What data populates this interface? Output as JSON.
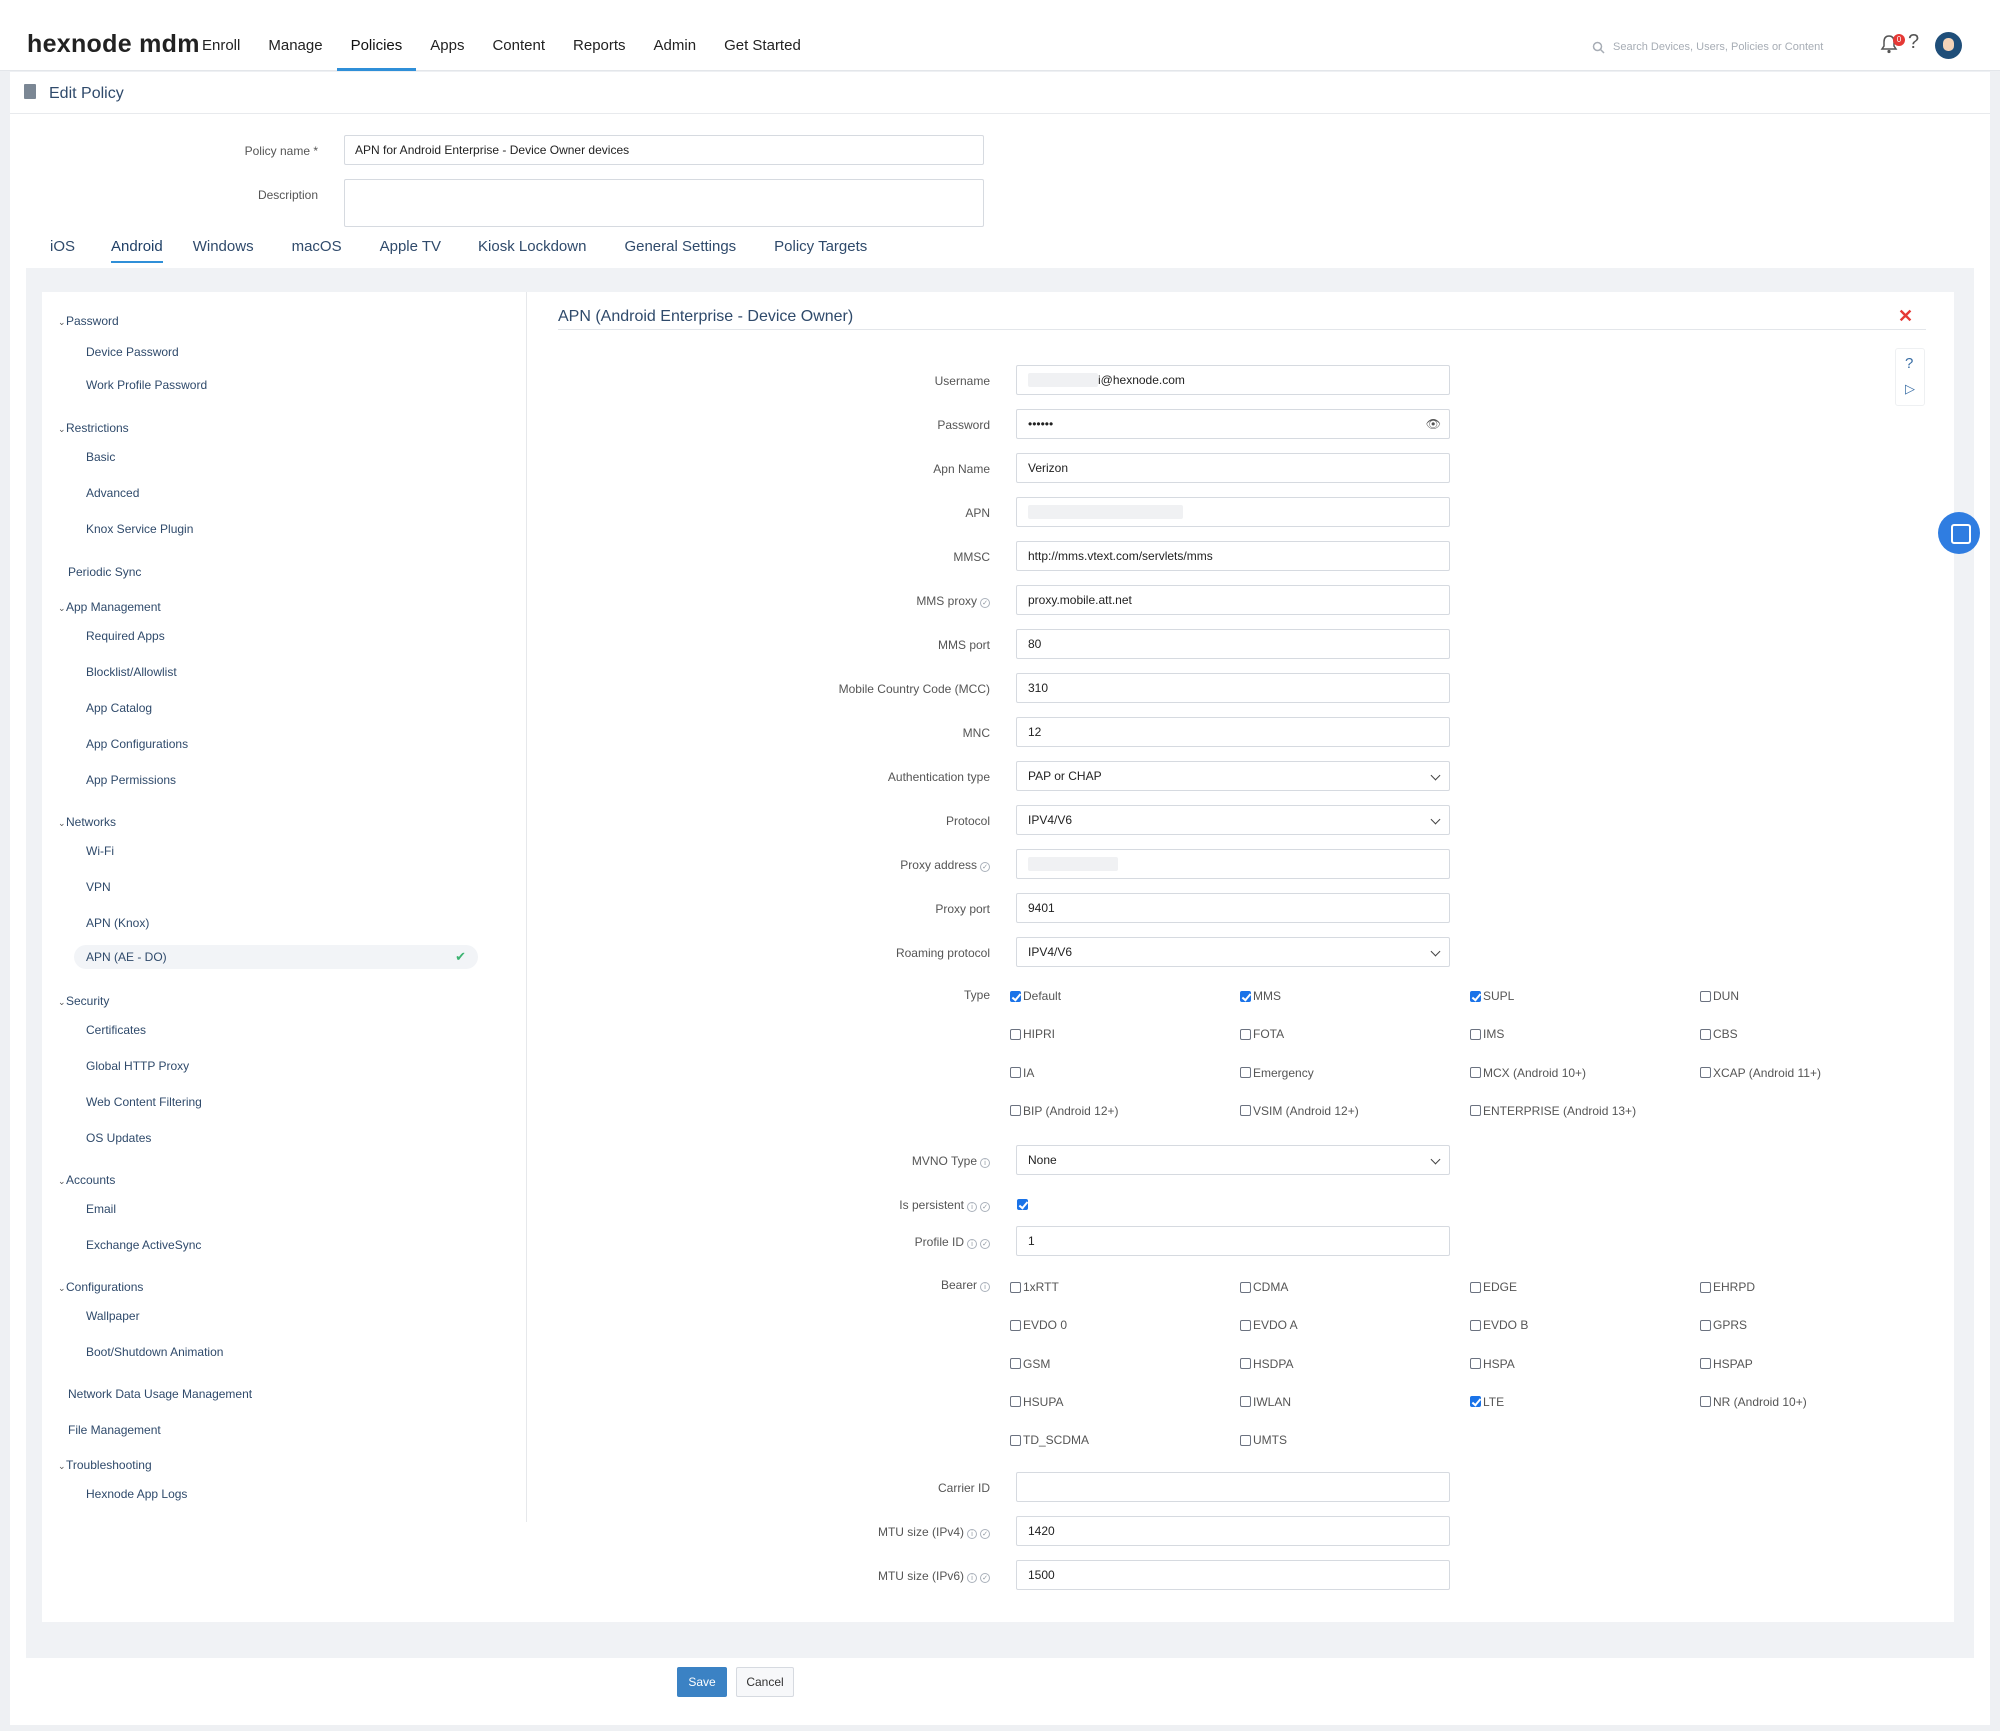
{
  "app": {
    "logo": "hexnode mdm",
    "nav": [
      "Enroll",
      "Manage",
      "Policies",
      "Apps",
      "Content",
      "Reports",
      "Admin",
      "Get Started"
    ],
    "active_nav": "Policies",
    "search_placeholder": "Search Devices, Users, Policies or Content",
    "notification_count": "0"
  },
  "page": {
    "title": "Edit Policy",
    "policy_name_label": "Policy name *",
    "policy_name_value": "APN for Android Enterprise - Device Owner devices",
    "description_label": "Description",
    "description_value": ""
  },
  "tabs": [
    "iOS",
    "Android",
    "Windows",
    "macOS",
    "Apple TV",
    "Kiosk Lockdown",
    "General Settings",
    "Policy Targets"
  ],
  "sidebar": {
    "groups": [
      {
        "label": "Password",
        "items": [
          "Device Password",
          "Work Profile Password"
        ]
      },
      {
        "label": "Restrictions",
        "items": [
          "Basic",
          "Advanced",
          "Knox Service Plugin"
        ]
      },
      {
        "label": "Periodic Sync",
        "items": []
      },
      {
        "label": "App Management",
        "items": [
          "Required Apps",
          "Blocklist/Allowlist",
          "App Catalog",
          "App Configurations",
          "App Permissions"
        ]
      },
      {
        "label": "Networks",
        "items": [
          "Wi-Fi",
          "VPN",
          "APN (Knox)",
          "APN (AE - DO)"
        ]
      },
      {
        "label": "Security",
        "items": [
          "Certificates",
          "Global HTTP Proxy",
          "Web Content Filtering",
          "OS Updates"
        ]
      },
      {
        "label": "Accounts",
        "items": [
          "Email",
          "Exchange ActiveSync"
        ]
      },
      {
        "label": "Configurations",
        "items": [
          "Wallpaper",
          "Boot/Shutdown Animation"
        ]
      },
      {
        "label": "Network Data Usage Management",
        "items": []
      },
      {
        "label": "File Management",
        "items": []
      },
      {
        "label": "Troubleshooting",
        "items": [
          "Hexnode App Logs"
        ]
      }
    ],
    "active_item": "APN (AE - DO)"
  },
  "section": {
    "title": "APN (Android Enterprise - Device Owner)",
    "fields": {
      "username_label": "Username",
      "username_value": "i@hexnode.com",
      "password_label": "Password",
      "password_value": "••••••",
      "apn_name_label": "Apn Name",
      "apn_name_value": "Verizon",
      "apn_label": "APN",
      "mmsc_label": "MMSC",
      "mmsc_value": "http://mms.vtext.com/servlets/mms",
      "mms_proxy_label": "MMS proxy",
      "mms_proxy_value": "proxy.mobile.att.net",
      "mms_port_label": "MMS port",
      "mms_port_value": "80",
      "mcc_label": "Mobile Country Code (MCC)",
      "mcc_value": "310",
      "mnc_label": "MNC",
      "mnc_value": "12",
      "auth_type_label": "Authentication type",
      "auth_type_value": "PAP or CHAP",
      "protocol_label": "Protocol",
      "protocol_value": "IPV4/V6",
      "proxy_address_label": "Proxy address",
      "proxy_port_label": "Proxy port",
      "proxy_port_value": "9401",
      "roaming_label": "Roaming protocol",
      "roaming_value": "IPV4/V6",
      "type_label": "Type",
      "mvno_label": "MVNO Type",
      "mvno_value": "None",
      "persistent_label": "Is persistent",
      "profile_id_label": "Profile ID",
      "profile_id_value": "1",
      "bearer_label": "Bearer",
      "carrier_id_label": "Carrier ID",
      "carrier_id_value": "",
      "mtu4_label": "MTU size (IPv4)",
      "mtu4_value": "1420",
      "mtu6_label": "MTU size (IPv6)",
      "mtu6_value": "1500"
    },
    "type_options": [
      {
        "label": "Default",
        "checked": true
      },
      {
        "label": "MMS",
        "checked": true
      },
      {
        "label": "SUPL",
        "checked": true
      },
      {
        "label": "DUN",
        "checked": false
      },
      {
        "label": "HIPRI",
        "checked": false
      },
      {
        "label": "FOTA",
        "checked": false
      },
      {
        "label": "IMS",
        "checked": false
      },
      {
        "label": "CBS",
        "checked": false
      },
      {
        "label": "IA",
        "checked": false
      },
      {
        "label": "Emergency",
        "checked": false
      },
      {
        "label": "MCX (Android 10+)",
        "checked": false
      },
      {
        "label": "XCAP (Android 11+)",
        "checked": false
      },
      {
        "label": "BIP (Android 12+)",
        "checked": false
      },
      {
        "label": "VSIM (Android 12+)",
        "checked": false
      },
      {
        "label": "ENTERPRISE (Android 13+)",
        "checked": false
      }
    ],
    "persistent_checked": true,
    "bearer_options": [
      {
        "label": "1xRTT",
        "checked": false
      },
      {
        "label": "CDMA",
        "checked": false
      },
      {
        "label": "EDGE",
        "checked": false
      },
      {
        "label": "EHRPD",
        "checked": false
      },
      {
        "label": "EVDO 0",
        "checked": false
      },
      {
        "label": "EVDO A",
        "checked": false
      },
      {
        "label": "EVDO B",
        "checked": false
      },
      {
        "label": "GPRS",
        "checked": false
      },
      {
        "label": "GSM",
        "checked": false
      },
      {
        "label": "HSDPA",
        "checked": false
      },
      {
        "label": "HSPA",
        "checked": false
      },
      {
        "label": "HSPAP",
        "checked": false
      },
      {
        "label": "HSUPA",
        "checked": false
      },
      {
        "label": "IWLAN",
        "checked": false
      },
      {
        "label": "LTE",
        "checked": true
      },
      {
        "label": "NR (Android 10+)",
        "checked": false
      },
      {
        "label": "TD_SCDMA",
        "checked": false
      },
      {
        "label": "UMTS",
        "checked": false
      }
    ]
  },
  "buttons": {
    "save": "Save",
    "cancel": "Cancel"
  },
  "colors": {
    "accent": "#2f8fd8",
    "save_button": "#3b82c4",
    "close": "#e53935",
    "active_check": "#3cb371"
  }
}
